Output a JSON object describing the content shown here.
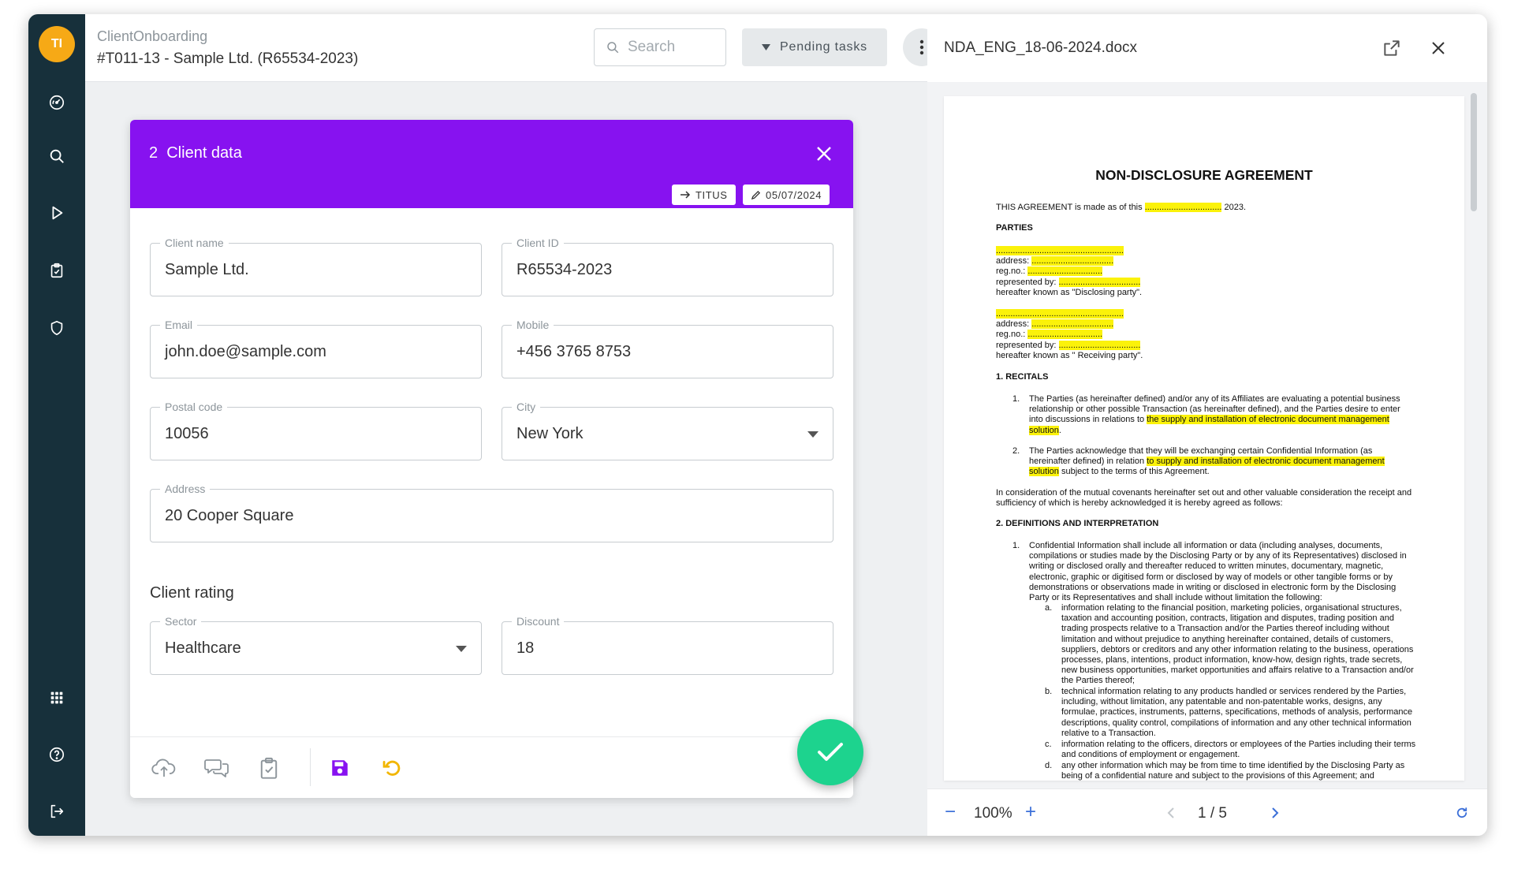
{
  "user": {
    "initials": "TI"
  },
  "sidebar": {
    "items": [
      {
        "icon": "dashboard-icon"
      },
      {
        "icon": "search-icon"
      },
      {
        "icon": "play-icon"
      },
      {
        "icon": "clipboard-check-icon"
      },
      {
        "icon": "shield-icon"
      },
      {
        "icon": "apps-grid-icon"
      },
      {
        "icon": "help-icon"
      },
      {
        "icon": "logout-icon"
      }
    ]
  },
  "header": {
    "app_name": "ClientOnboarding",
    "record_title": "#T011-13 - Sample Ltd. (R65534-2023)",
    "search_placeholder": "Search",
    "pending_label": "Pending tasks"
  },
  "card": {
    "title": "2  Client data",
    "chips": {
      "assignee": "TITUS",
      "date": "05/07/2024"
    },
    "fields": {
      "client_name": {
        "label": "Client name",
        "value": "Sample Ltd."
      },
      "client_id": {
        "label": "Client ID",
        "value": "R65534-2023"
      },
      "email": {
        "label": "Email",
        "value": "john.doe@sample.com"
      },
      "mobile": {
        "label": "Mobile",
        "value": "+456 3765 8753"
      },
      "postal_code": {
        "label": "Postal code",
        "value": "10056"
      },
      "city": {
        "label": "City",
        "value": "New York"
      },
      "address": {
        "label": "Address",
        "value": "20 Cooper Square"
      },
      "sector": {
        "label": "Sector",
        "value": "Healthcare"
      },
      "discount": {
        "label": "Discount",
        "value": "18"
      }
    },
    "section_rating": "Client rating"
  },
  "colors": {
    "sidebar": "#17303b",
    "avatar": "#f6a916",
    "card_header": "#8712f0",
    "confirm": "#1dd38e",
    "save_icon": "#8712f0",
    "undo_icon": "#f2b600",
    "highlight": "#fbf20a",
    "link": "#3b6fd8"
  },
  "viewer": {
    "file_name": "NDA_ENG_18-06-2024.docx",
    "zoom": "100%",
    "page": "1 / 5",
    "zoom_out": "−",
    "zoom_in": "+",
    "doc": {
      "title": "NON-DISCLOSURE AGREEMENT",
      "intro_pre": "THIS AGREEMENT is made as of this ",
      "intro_blank": "................................",
      "intro_post": " 2023.",
      "parties_heading": "PARTIES",
      "party1": {
        "blank": ".....................................................",
        "address": "address: ",
        "address_blank": "..................................",
        "reg": "reg.no.: ",
        "reg_blank": "...............................",
        "rep": "represented by: ",
        "rep_blank": "..................................",
        "known": "hereafter known as \"Disclosing party\"."
      },
      "party2": {
        "blank": ".....................................................",
        "address": "address: ",
        "address_blank": "..................................",
        "reg": "reg.no.: ",
        "reg_blank": "...............................",
        "rep": "represented by: ",
        "rep_blank": "..................................",
        "known": "hereafter known as \" Receiving party\"."
      },
      "recitals_heading": "1. RECITALS",
      "recital1_num": "1.",
      "recital1_a": "The Parties (as hereinafter defined) and/or any of its Affiliates are evaluating a potential business",
      "recital1_b": "relationship or other possible Transaction (as hereinafter defined), and the Parties desire to enter",
      "recital1_c": "into discussions in relations to ",
      "recital1_c_hl": "the supply and installation of electronic document management",
      "recital1_d_hl": "solution",
      "recital1_d": ".",
      "recital2_num": "2.",
      "recital2_a": "The Parties acknowledge that they will be exchanging certain Confidential Information (as",
      "recital2_b": "hereinafter defined) in relation ",
      "recital2_b_hl": "to supply and installation of electronic document management",
      "recital2_c_hl": "solution",
      "recital2_c": " subject to the terms of this Agreement.",
      "consideration_a": "In consideration of the mutual covenants hereinafter set out and other valuable consideration the receipt and",
      "consideration_b": "sufficiency of which is hereby acknowledged it is hereby agreed as follows:",
      "definitions_heading": "2. DEFINITIONS AND INTERPRETATION",
      "def_num": "1.",
      "def_lines": [
        "Confidential Information shall include all information or data (including analyses, documents,",
        "compilations or studies made by the Disclosing Party or by any of its Representatives) disclosed in",
        "writing or disclosed orally and thereafter reduced to written minutes, documentary, magnetic,",
        "electronic, graphic or digitised form or disclosed by way of models or other tangible forms or by",
        "demonstrations or observations made in writing or disclosed in electronic form by the Disclosing",
        "Party or its Representatives and shall include without limitation the following:"
      ],
      "sub_a_label": "a.",
      "sub_a": [
        "information relating to the financial position, marketing policies, organisational structures,",
        "taxation and accounting position, contracts, litigation and disputes, trading position and",
        "trading prospects relative to a Transaction and/or the Parties thereof including without",
        "limitation and without prejudice to anything hereinafter contained, details of customers,",
        "suppliers, debtors or creditors and any other information relating to the business, operations",
        "processes, plans, intentions, product information, know-how, design rights, trade secrets,",
        "new business opportunities, market opportunities and affairs relative to a Transaction and/or",
        "the Parties thereof;"
      ],
      "sub_b_label": "b.",
      "sub_b": [
        "technical information relating to any products handled or services rendered by the Parties,",
        "including, without limitation, any patentable and non-patentable works, designs, any",
        "formulae, practices, instruments, patterns, specifications, methods of analysis, performance",
        "descriptions, quality control, compilations of information and any other technical information",
        "relative to a Transaction."
      ],
      "sub_c_label": "c.",
      "sub_c": [
        "information relating to the officers, directors or employees of the Parties including their terms",
        "and conditions of employment or engagement."
      ],
      "sub_d_label": "d.",
      "sub_d": [
        "any other information which may be from time to time identified by the Disclosing Party as",
        "being of a confidential nature and subject to the provisions of this Agreement; and"
      ]
    }
  }
}
